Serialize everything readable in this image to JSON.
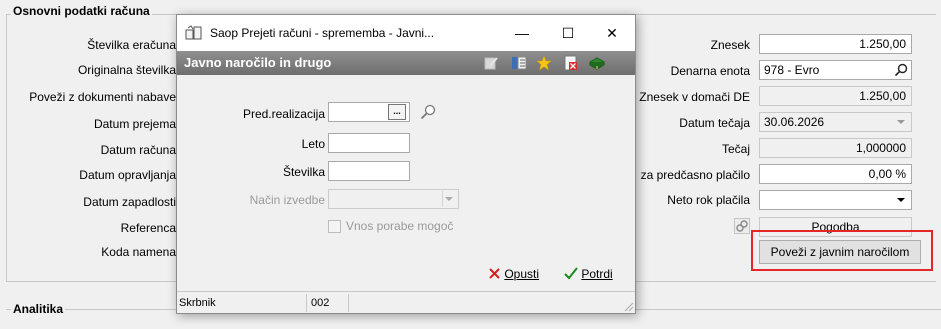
{
  "form": {
    "section_title": "Osnovni podatki računa",
    "section2_title": "Analitika",
    "left_labels": [
      "Številka eračuna",
      "Originalna številka",
      "Poveži z dokumenti nabave",
      "Datum prejema",
      "Datum računa",
      "Datum opravljanja",
      "Datum zapadlosti",
      "Referenca",
      "Koda namena"
    ],
    "right": {
      "znesek_label": "Znesek",
      "znesek_value": "1.250,00",
      "denarna_label": "Denarna enota",
      "denarna_value": "978 - Evro",
      "znesek_dom_label": "Znesek v domači DE",
      "znesek_dom_value": "1.250,00",
      "datum_tecaja_label": "Datum tečaja",
      "datum_tecaja_value": "30.06.2026",
      "tecaj_label": "Tečaj",
      "tecaj_value": "1,000000",
      "predcasno_label": "za predčasno plačilo",
      "predcasno_value": "0,00 %",
      "neto_label": "Neto rok plačila",
      "neto_value": "",
      "pogodba_label": "Pogodba",
      "povezi_label": "Poveži z javnim naročilom"
    }
  },
  "dialog": {
    "window_title": "Saop Prejeti računi - sprememba - Javni...",
    "header_title": "Javno naročilo in drugo",
    "fields": {
      "pred_label": "Pred.realizacija",
      "pred_value": "",
      "leto_label": "Leto",
      "leto_value": "",
      "stevilka_label": "Številka",
      "stevilka_value": "",
      "nacin_label": "Način izvedbe",
      "nacin_value": "",
      "vnos_label": "Vnos porabe mogoč"
    },
    "ellipsis_label": "...",
    "buttons": {
      "opusti": "Opusti",
      "potrdi": "Potrdi"
    },
    "status": {
      "user_label": "Skrbnik",
      "code": "002"
    },
    "window_controls": {
      "minimize": "—",
      "maximize": "☐",
      "close": "✕"
    }
  },
  "colors": {
    "header_gray": "#7a7a7a",
    "highlight_red": "#e32626",
    "cancel_red": "#d42020",
    "confirm_green": "#1a8a1a"
  }
}
